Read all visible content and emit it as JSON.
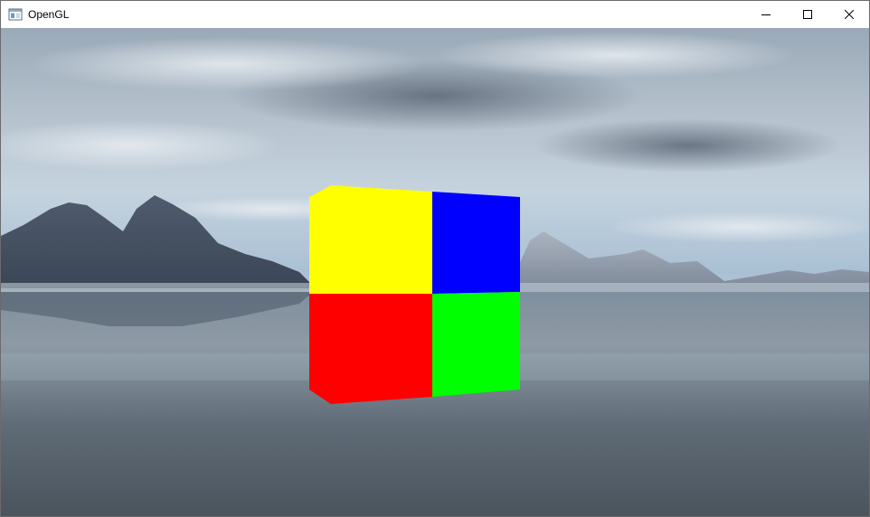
{
  "window": {
    "title": "OpenGL",
    "icon": "app-window-icon",
    "controls": {
      "minimize_icon": "minimize-icon",
      "maximize_icon": "maximize-icon",
      "close_icon": "close-icon"
    }
  },
  "scene": {
    "cube_face_colors": {
      "top_left": "#ffff00",
      "top_right": "#0000ff",
      "bottom_left": "#ff0000",
      "bottom_right": "#00ff00"
    },
    "sky_color": "#8aa7c4",
    "water_color": "#5c6773"
  }
}
